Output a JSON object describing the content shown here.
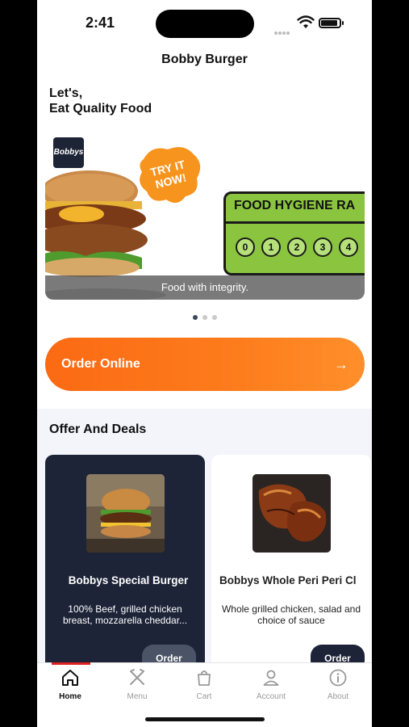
{
  "status_bar": {
    "time": "2:41"
  },
  "header": {
    "title": "Bobby Burger"
  },
  "greeting": {
    "line1": "Let's,",
    "line2": "Eat Quality Food"
  },
  "banner": {
    "logo_text": "Bobbys",
    "promo_text": "TRY IT NOW!",
    "hygiene_title": "FOOD HYGIENE RA",
    "ratings": [
      "0",
      "1",
      "2",
      "3",
      "4"
    ],
    "caption": "Food with integrity.",
    "slide_count": 3,
    "active_slide": 0
  },
  "order_online": {
    "label": "Order Online",
    "arrow": "→"
  },
  "offers": {
    "title": "Offer And Deals",
    "items": [
      {
        "name": "Bobbys Special Burger",
        "description": "100% Beef, grilled chicken breast, mozzarella cheddar...",
        "button": "Order"
      },
      {
        "name": "Bobbys Whole Peri Peri Cl",
        "description": "Whole grilled chicken, salad and choice of sauce",
        "button": "Order"
      }
    ]
  },
  "tabs": [
    {
      "label": "Home",
      "icon": "home-icon",
      "active": true
    },
    {
      "label": "Menu",
      "icon": "utensils-icon",
      "active": false
    },
    {
      "label": "Cart",
      "icon": "bag-icon",
      "active": false
    },
    {
      "label": "Account",
      "icon": "user-icon",
      "active": false
    },
    {
      "label": "About",
      "icon": "info-icon",
      "active": false
    }
  ],
  "colors": {
    "accent": "#fb6a14",
    "navy": "#1d2438",
    "tab_indicator": "#e02020",
    "hygiene_green": "#8bc53f"
  }
}
